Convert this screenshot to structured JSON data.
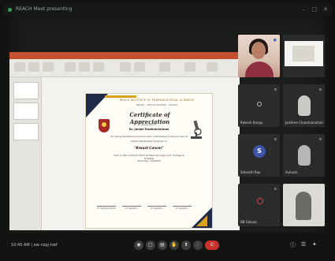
{
  "window": {
    "title": "REACH Meet presenting"
  },
  "certificate": {
    "heading": "REACH INSTITUTE OF PHARMACEUTICAL SCIENCES",
    "subheading": "REACH • REACH PHARMA • REACH",
    "title": "Certificate of Appreciation",
    "presented_to": "Presented to",
    "recipient": "Dr. Janaki Radhakrishnan",
    "body": "for being the Resource person and contributing to the success of",
    "body2": "Alumni Mentorship Program on",
    "program": "\"Breast Cancer\"",
    "body3": "held on 8th of March 2023 at Pharmacology Unit, College & Hospital",
    "date": "Thursday, 3/9/2023",
    "signatories": [
      "Dr. Signatory Name",
      "Dr. Signatory",
      "Dr. Signatory",
      "Dr. Signatory"
    ]
  },
  "participants": [
    {
      "name": "",
      "type": "video"
    },
    {
      "name": "",
      "type": "screen"
    },
    {
      "name": "Rakesh Rangu",
      "type": "ring"
    },
    {
      "name": "Jaishree Chandramohan",
      "type": "silhouette"
    },
    {
      "name": "Srikanth Ray",
      "type": "initial",
      "initial": "S"
    },
    {
      "name": "Avinash",
      "type": "silhouette"
    },
    {
      "name": "BB Gokula",
      "type": "ring"
    },
    {
      "name": "",
      "type": "video-dim"
    }
  ],
  "toolbar": {
    "time": "10:45 AM | ew-nzpj-hwf",
    "icons": [
      "mic-icon",
      "camera-icon",
      "captions-icon",
      "raise-hand-icon",
      "present-icon",
      "more-icon"
    ],
    "icon_glyphs": [
      "◉",
      "▢",
      "▤",
      "✋",
      "⬆",
      "⋮"
    ],
    "end_call_glyph": "✆",
    "right_icons": [
      "ⓘ",
      "☰",
      "✦"
    ]
  },
  "colors": {
    "ribbon": "#c4502f",
    "end_call": "#c8322c",
    "certificate_navy": "#1e2a48",
    "certificate_gold": "#d9a21d"
  }
}
